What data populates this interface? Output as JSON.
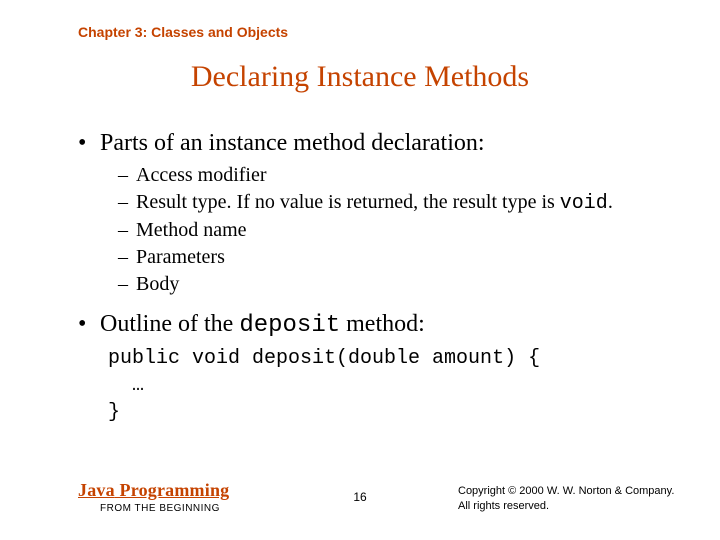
{
  "chapter": "Chapter 3: Classes and Objects",
  "title": "Declaring Instance Methods",
  "bullet1": "Parts of an instance method declaration:",
  "sub1": "Access modifier",
  "sub2a": "Result type. If no value is returned, the result type is ",
  "sub2b": "void",
  "sub2c": ".",
  "sub3": "Method name",
  "sub4": "Parameters",
  "sub5": "Body",
  "bullet2a": "Outline of the ",
  "bullet2b": "deposit",
  "bullet2c": " method:",
  "code1": "public void deposit(double amount) {",
  "code2": "  …",
  "code3": "}",
  "footer": {
    "java": "Java",
    "programming": " Programming",
    "from": "FROM THE BEGINNING",
    "page": "16",
    "copyright1": "Copyright © 2000 W. W. Norton & Company.",
    "copyright2": "All rights reserved."
  }
}
